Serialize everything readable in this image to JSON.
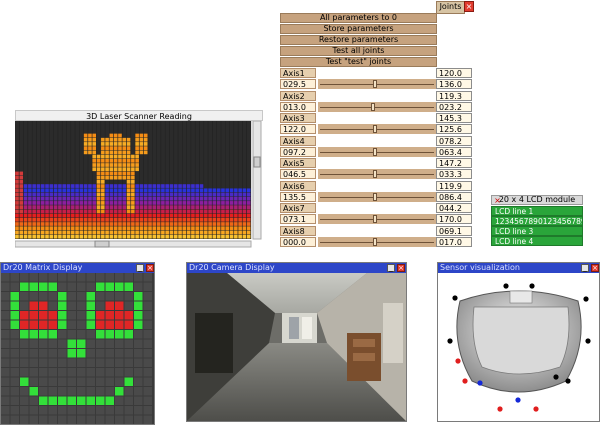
{
  "joints": {
    "title_tab": "Joints",
    "close_glyph": "×",
    "buttons": [
      "All parameters to 0",
      "Store parameters",
      "Restore parameters",
      "Test all joints",
      "Test \"test\" joints"
    ],
    "axes": [
      {
        "label": "Axis1",
        "input": "029.5",
        "top_value": "120.0",
        "bottom_value": "136.0",
        "level": 0.49
      },
      {
        "label": "Axis2",
        "input": "013.0",
        "top_value": "119.3",
        "bottom_value": "023.2",
        "level": 0.47
      },
      {
        "label": "Axis3",
        "input": "122.0",
        "top_value": "145.3",
        "bottom_value": "125.6",
        "level": 0.49
      },
      {
        "label": "Axis4",
        "input": "097.2",
        "top_value": "078.2",
        "bottom_value": "063.4",
        "level": 0.49
      },
      {
        "label": "Axis5",
        "input": "046.5",
        "top_value": "147.2",
        "bottom_value": "033.3",
        "level": 0.49
      },
      {
        "label": "Axis6",
        "input": "135.5",
        "top_value": "119.9",
        "bottom_value": "086.4",
        "level": 0.49
      },
      {
        "label": "Axis7",
        "input": "073.1",
        "top_value": "044.2",
        "bottom_value": "170.0",
        "level": 0.49
      },
      {
        "label": "Axis8",
        "input": "000.0",
        "top_value": "069.1",
        "bottom_value": "017.0",
        "level": 0.49
      }
    ]
  },
  "laser": {
    "title": "3D Laser Scanner Reading"
  },
  "lcd": {
    "title": "20 x 4 LCD module",
    "close_glyph": "×",
    "lines": [
      "LCD line 1",
      "12345678901234567890",
      "LCD line 3",
      "LCD line 4"
    ]
  },
  "matrix": {
    "title": "Dr20 Matrix Display",
    "min_glyph": "_",
    "close_glyph": "×",
    "colors": {
      "bg": "#3a3a3a",
      "green": "#33e03a",
      "red": "#e02626"
    }
  },
  "camera": {
    "title": "Dr20 Camera Display",
    "min_glyph": "_",
    "close_glyph": "×"
  },
  "sensor": {
    "title": "Sensor visualization",
    "min_glyph": "_",
    "close_glyph": "×",
    "colors": {
      "black": "#000000",
      "red": "#e01e1e",
      "blue": "#1428d8"
    }
  }
}
